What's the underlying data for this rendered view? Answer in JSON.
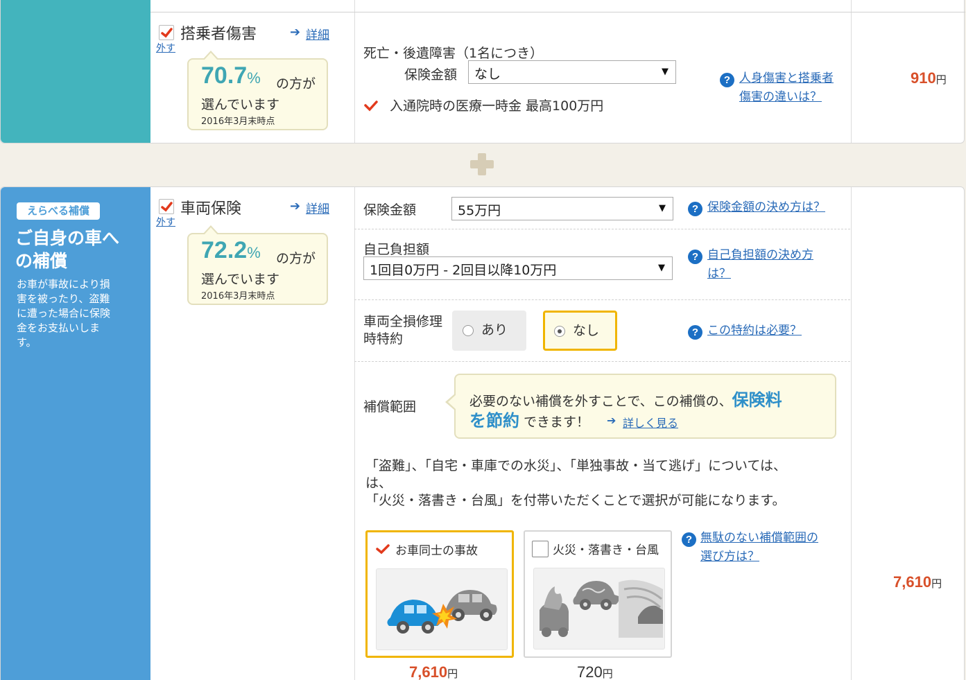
{
  "colors": {
    "accent_teal": "#43b4bd",
    "accent_blue": "#4e9ed8",
    "price_orange": "#d8502a",
    "link_blue": "#2a6bb8",
    "highlight_yellow": "#f0b500"
  },
  "passenger": {
    "title": "搭乗者傷害",
    "remove": "外す",
    "detail": "詳細",
    "pct": "70.7",
    "pct_unit": "%",
    "pct_suffix": "の方が",
    "chosen": "選んでいます",
    "asof": "2016年3月末時点",
    "death_label": "死亡・後遺障害（1名につき）",
    "amount_label": "保険金額",
    "amount_value": "なし",
    "medical_text": "入通院時の医療一時金 最高100万円",
    "help_line1": "人身傷害と搭乗者",
    "help_line2": "傷害の違いは？",
    "price": "910",
    "yen": "円"
  },
  "vehicle": {
    "side_badge": "えらべる補償",
    "side_title_line1": "ご自身の車へ",
    "side_title_line2": "の補償",
    "side_desc_lines": [
      "お車が事故により損",
      "害を被ったり、盗難",
      "に遭った場合に保険",
      "金をお支払いしま",
      "す。"
    ],
    "title": "車両保険",
    "remove": "外す",
    "detail": "詳細",
    "pct": "72.2",
    "pct_unit": "%",
    "pct_suffix": "の方が",
    "chosen": "選んでいます",
    "asof": "2016年3月末時点",
    "amount_label": "保険金額",
    "amount_value": "55万円",
    "amount_help": "保険金額の決め方は？",
    "deductible_label": "自己負担額",
    "deductible_value": "1回目0万円 - 2回目以降10万円",
    "deductible_help_line1": "自己負担額の決め方",
    "deductible_help_line2": "は？",
    "rider_label_line1": "車両全損修理",
    "rider_label_line2": "時特約",
    "rider_yes": "あり",
    "rider_no": "なし",
    "rider_help": "この特約は必要？",
    "scope_label": "補償範囲",
    "tip_text1": "必要のない補償を外すことで、この補償の、",
    "tip_strong1": "保険料",
    "tip_strong2": "を節約",
    "tip_text2": "できます！",
    "tip_link": "詳しく見る",
    "note_line1": "「盗難」、「自宅・車庫での水災」、「単独事故・当て逃げ」については、",
    "note_line2": "は、",
    "note_line3": "「火災・落書き・台風」を付帯いただくことで選択が可能になります。",
    "option1_label": "お車同士の事故",
    "option1_price": "7,610",
    "option2_label": "火災・落書き・台風",
    "option2_price": "720",
    "yen": "円",
    "options_help_line1": "無駄のない補償範囲の",
    "options_help_line2": "選び方は？",
    "price": "7,610"
  },
  "icons": {
    "check": "check-icon",
    "arrow": "arrow-right-icon",
    "help": "question-circle-icon",
    "plus": "plus-icon",
    "caret": "caret-down-icon"
  }
}
